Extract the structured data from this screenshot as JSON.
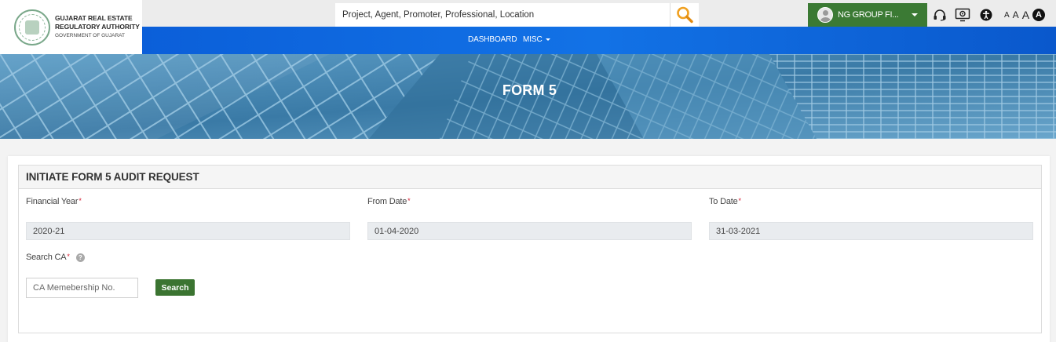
{
  "header": {
    "logo": {
      "line1": "GUJARAT REAL ESTATE",
      "line2": "REGULATORY AUTHORITY",
      "line3": "GOVERNMENT OF GUJARAT"
    },
    "search": {
      "placeholder": "Project, Agent, Promoter, Professional, Location"
    },
    "user": {
      "name": "NG GROUP FI..."
    },
    "font_sizes": [
      "A",
      "A",
      "A",
      "A"
    ]
  },
  "nav": {
    "items": [
      {
        "label": "DASHBOARD"
      },
      {
        "label": "MISC"
      }
    ]
  },
  "banner": {
    "title": "FORM 5"
  },
  "form": {
    "panel_title": "INITIATE FORM 5 AUDIT REQUEST",
    "required_mark": "*",
    "financial_year": {
      "label": "Financial Year",
      "value": "2020-21"
    },
    "from_date": {
      "label": "From Date",
      "value": "01-04-2020"
    },
    "to_date": {
      "label": "To Date",
      "value": "31-03-2021"
    },
    "search_ca": {
      "label": "Search CA",
      "help": "?",
      "placeholder": "CA Memebership No.",
      "button_label": "Search"
    }
  },
  "colors": {
    "nav_blue": "#0b5fd9",
    "user_green": "#3b7a34",
    "button_green": "#3b7431",
    "required_red": "#d4182d"
  },
  "icons": [
    "search-icon",
    "avatar",
    "headset-icon",
    "screen-reader-icon",
    "accessibility-icon",
    "help-icon",
    "chevron-down-icon"
  ]
}
